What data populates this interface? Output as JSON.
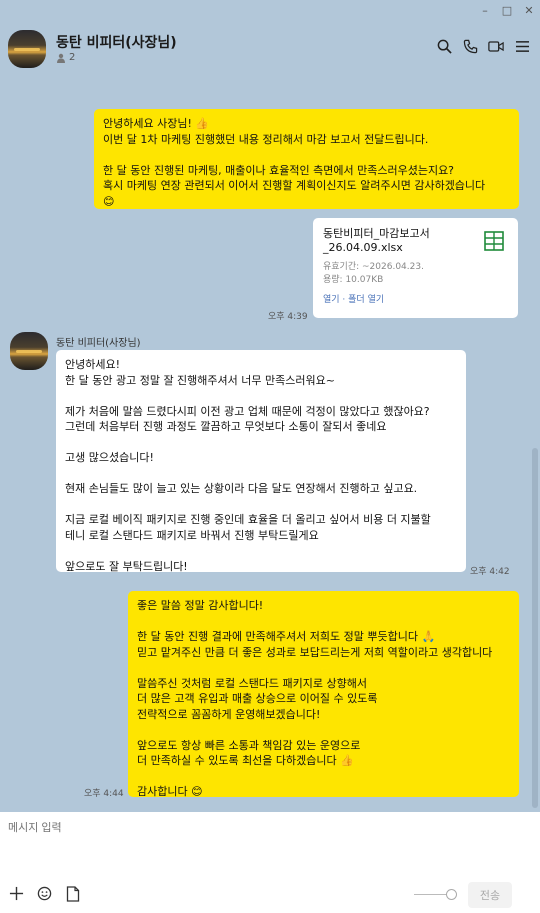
{
  "window": {
    "minimize": "–",
    "maximize": "□",
    "close": "✕"
  },
  "header": {
    "title": "동탄 비피터(사장님)",
    "member_count": "2",
    "icons": [
      "search-icon",
      "phone-icon",
      "video-icon",
      "menu-icon"
    ]
  },
  "messages": {
    "m1": {
      "text": "안녕하세요 사장님! 👍\n이번 달 1차 마케팅 진행했던 내용 정리해서 마감 보고서 전달드립니다.\n\n한 달 동안 진행된 마케팅, 매출이나 효율적인 측면에서 만족스러우셨는지요?\n혹시 마케팅 연장 관련되서 이어서 진행할 계획이신지도 알려주시면 감사하겠습니다\n😊"
    },
    "file": {
      "name": "동탄비피터_마감보고서_26.04.09.xlsx",
      "expiry": "유효기간: ~2026.04.23.",
      "size": "용량: 10.07KB",
      "actions": "열기 · 폴더 열기",
      "time": "오후 4:39"
    },
    "sender_name": "동탄 비피터(사장님)",
    "m2": {
      "text": "안녕하세요!\n한 달 동안 광고 정말 잘 진행해주셔서 너무 만족스러워요~\n\n제가 처음에 말씀 드렸다시피 이전 광고 업체 때문에 걱정이 많았다고 했잖아요?\n그런데 처음부터 진행 과정도 깔끔하고 무엇보다 소통이 잘되서 좋네요\n\n고생 많으셨습니다!\n\n현재 손님들도 많이 늘고 있는 상황이라 다음 달도 연장해서 진행하고 싶고요.\n\n지금 로컬 베이직 패키지로 진행 중인데 효율을 더 올리고 싶어서 비용 더 지불할\n테니 로컬 스탠다드 패키지로 바꿔서 진행 부탁드릴게요\n\n앞으로도 잘 부탁드립니다!",
      "time": "오후 4:42"
    },
    "m3": {
      "text": "좋은 말씀 정말 감사합니다!\n\n한 달 동안 진행 결과에 만족해주셔서 저희도 정말 뿌듯합니다 🙏\n믿고 맡겨주신 만큼 더 좋은 성과로 보답드리는게 저희 역할이라고 생각합니다\n\n말씀주신 것처럼 로컬 스탠다드 패키지로 상향해서\n더 많은 고객 유입과 매출 상승으로 이어질 수 있도록\n전략적으로 꼼꼼하게 운영해보겠습니다!\n\n앞으로도 항상 빠른 소통과 책임감 있는 운영으로\n더 만족하실 수 있도록 최선을 다하겠습니다 👍\n\n감사합니다 😊",
      "time": "오후 4:44"
    }
  },
  "composer": {
    "placeholder": "메시지 입력",
    "send_label": "전송",
    "icons": [
      "plus-icon",
      "emoji-icon",
      "file-icon"
    ]
  }
}
